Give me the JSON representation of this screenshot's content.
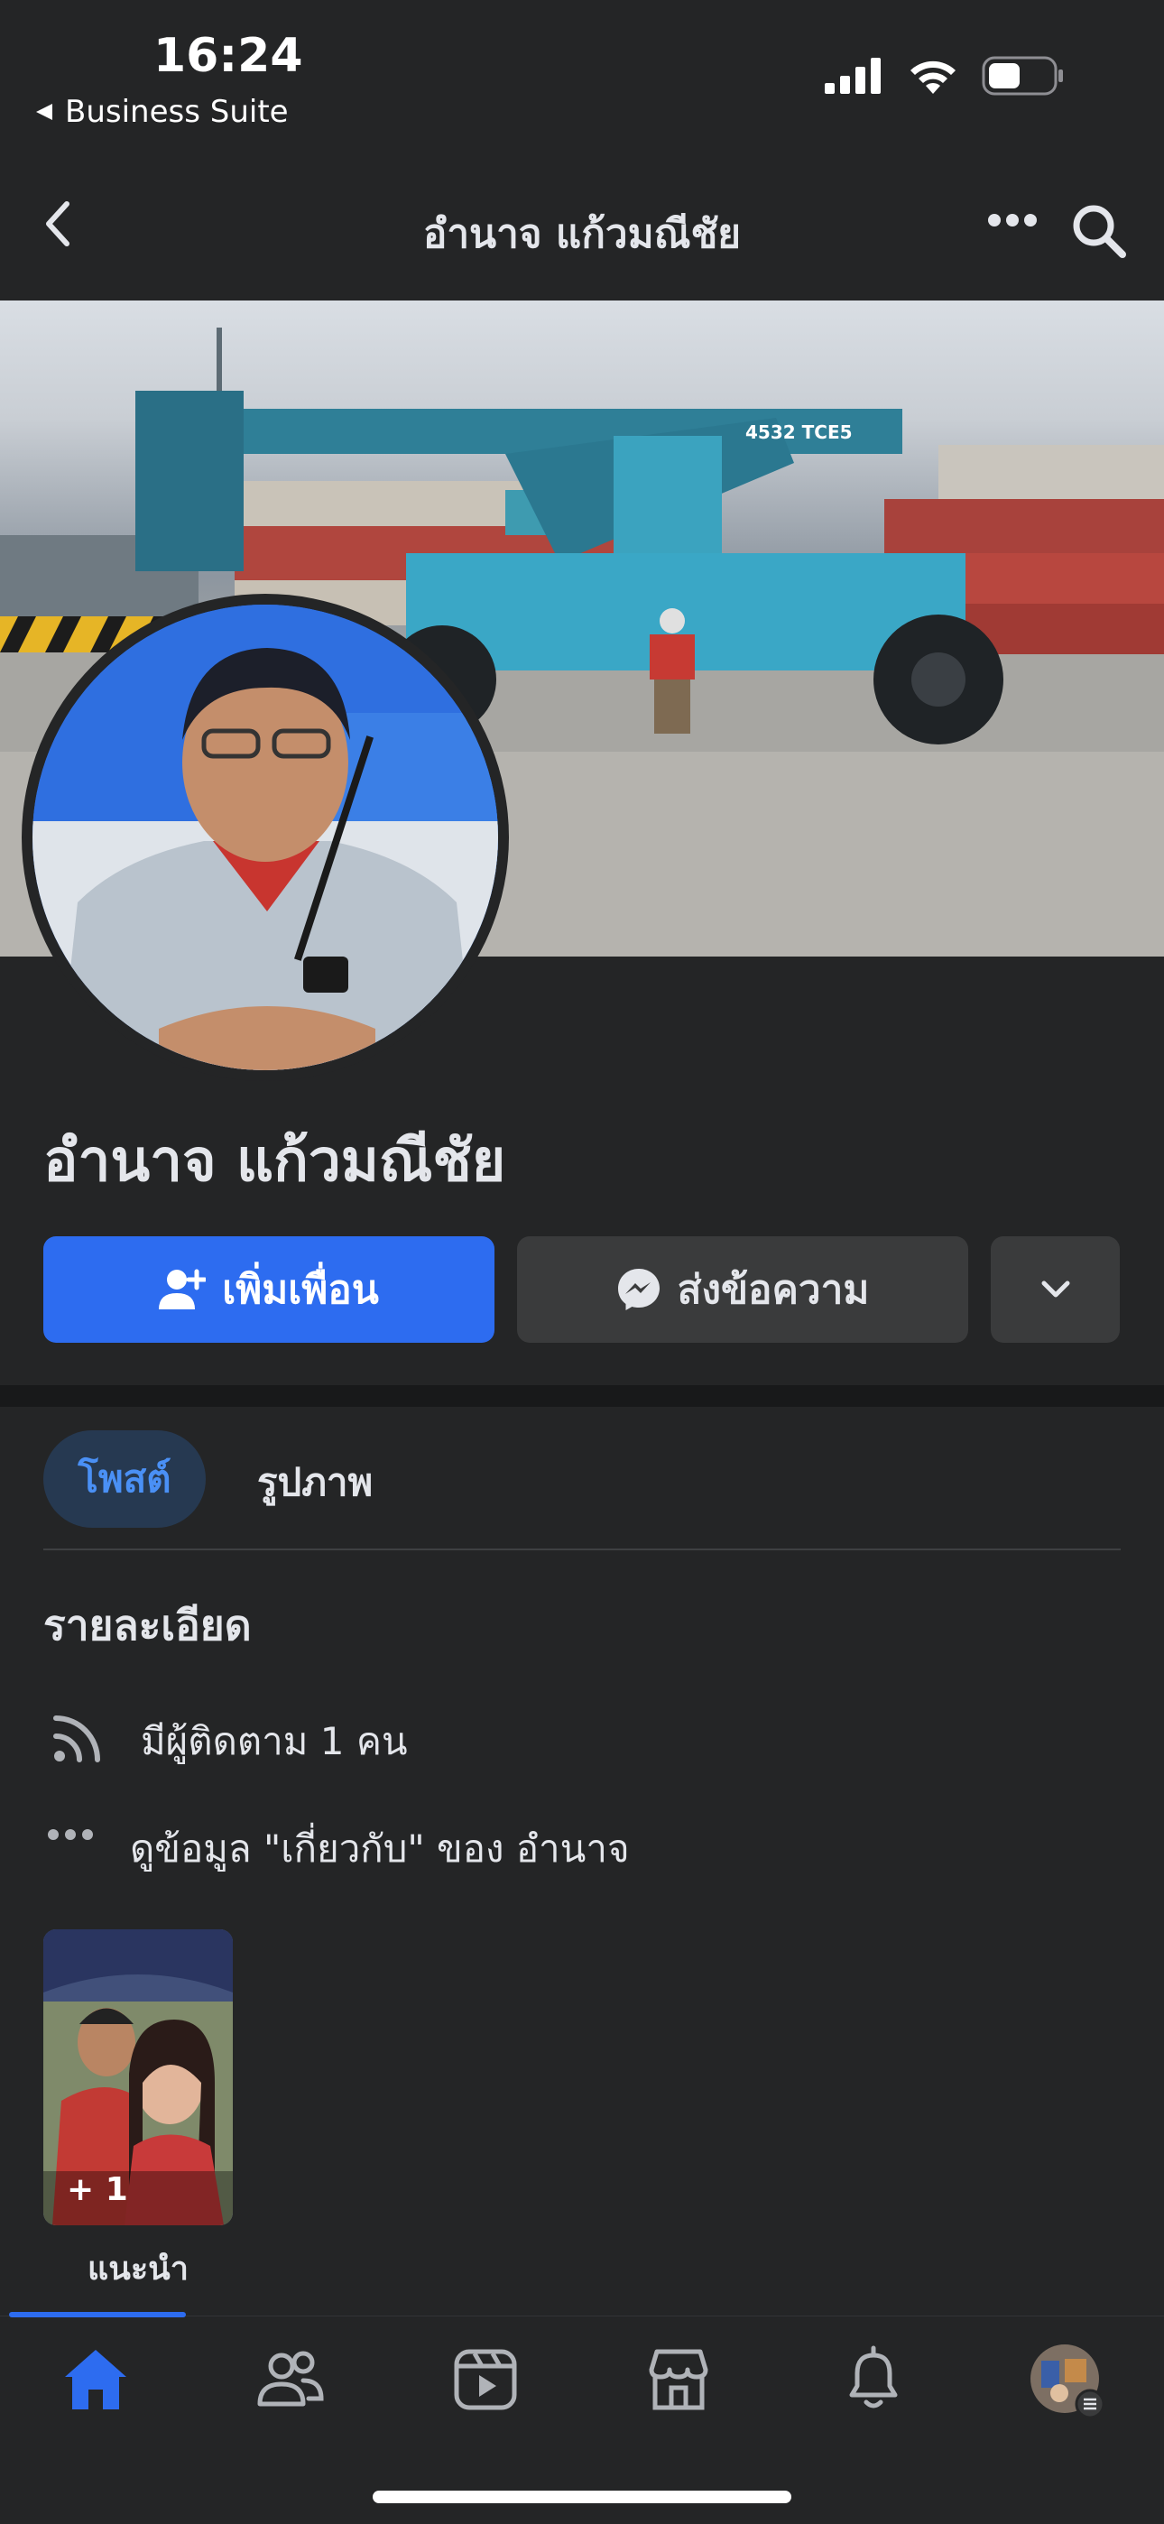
{
  "status_bar": {
    "time": "16:24",
    "back_app": "Business Suite"
  },
  "nav": {
    "title": "อำนาจ แก้วมณีชัย"
  },
  "cover": {
    "vehicle_label": "4532 TCE5"
  },
  "profile": {
    "name": "อำนาจ แก้วมณีชัย"
  },
  "actions": {
    "add_friend": "เพิ่มเพื่อน",
    "message": "ส่งข้อความ"
  },
  "tabs": {
    "posts": "โพสต์",
    "photos": "รูปภาพ"
  },
  "details": {
    "title": "รายละเอียด",
    "followers": "มีผู้ติดตาม 1 คน",
    "about": "ดูข้อมูล \"เกี่ยวกับ\" ของ อำนาจ"
  },
  "featured": {
    "count": "+ 1",
    "label": "แนะนำ"
  },
  "colors": {
    "accent": "#2d6cf0",
    "background": "#242526",
    "secondary_button": "#3a3b3c"
  },
  "icons": [
    "home-icon",
    "friends-icon",
    "watch-icon",
    "marketplace-icon",
    "bell-icon",
    "profile-menu-icon"
  ]
}
